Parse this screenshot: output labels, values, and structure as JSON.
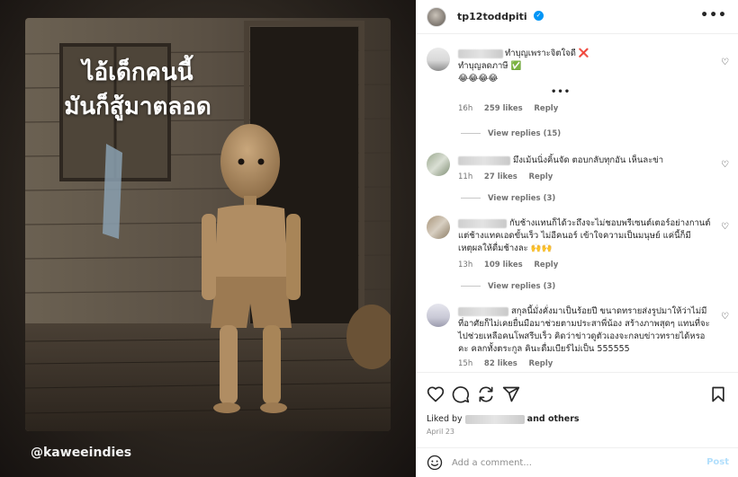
{
  "post": {
    "overlay_lines": [
      "ไอ้เด็กคนนี้",
      "มันก็สู้มาตลอด"
    ],
    "watermark": "@kaweeindies"
  },
  "header": {
    "username": "tp12toddpiti",
    "verified_icon": "verified-badge-icon",
    "more_label": "•••"
  },
  "comments": [
    {
      "text_lines": [
        "ทำบุญเพราะจิตใจดี ❌",
        "ทำบุญลดภาษี ✅",
        "😂😂😂😂"
      ],
      "more_indicator": "•••",
      "time": "16h",
      "likes": "259 likes",
      "reply": "Reply",
      "view_replies": "View replies (15)"
    },
    {
      "text_lines": [
        "มึงเม้นนิ่งคิ้นจัด ตอบกลับทุกอัน เห็นละข่า"
      ],
      "time": "11h",
      "likes": "27 likes",
      "reply": "Reply",
      "view_replies": "View replies (3)"
    },
    {
      "text_lines": [
        "กับช้างแทนก็ได้วะถึงจะไม่ชอบพรีเซนต์เตอร์อย่างกานต์",
        "แต่ช้างแทคเอดขั้นเร็ว ไม่อีคนอร์ เข้าใจความเป็นมนุษย์ แค่นี้ก็มี",
        "เหตุผลให้ดื่มช้างละ 🙌🙌"
      ],
      "time": "13h",
      "likes": "109 likes",
      "reply": "Reply",
      "view_replies": "View replies (3)"
    },
    {
      "text_lines": [
        "สกุลนี้มั่งคั่งมาเป็นร้อยปี ขนาดทรายส่งรูปมาให้ว่าไม่มี",
        "ที่อาศัยก็ไม่เคยยื่นมือมาช่วยตามประสาพี่น้อง สร้างภาพสุดๆ แทนที่จะ",
        "ไปช่วยเหลือคนโพสรีบเร็ว คิดว่าข่าวดูตัวเองจะกลบข่าวทรายได้หรอ",
        "คะ คลกทั้งตระกูล คินะดื่มเบียร์ไม่เป็น 555555"
      ],
      "time": "15h",
      "likes": "82 likes",
      "reply": "Reply"
    }
  ],
  "actions": {
    "icons": [
      "heart-icon",
      "comment-icon",
      "share-icon",
      "send-icon",
      "bookmark-icon"
    ]
  },
  "liked_by": {
    "prefix": "Liked by",
    "suffix": "and others"
  },
  "date": "April 23",
  "add_comment": {
    "placeholder": "Add a comment...",
    "post_label": "Post"
  }
}
